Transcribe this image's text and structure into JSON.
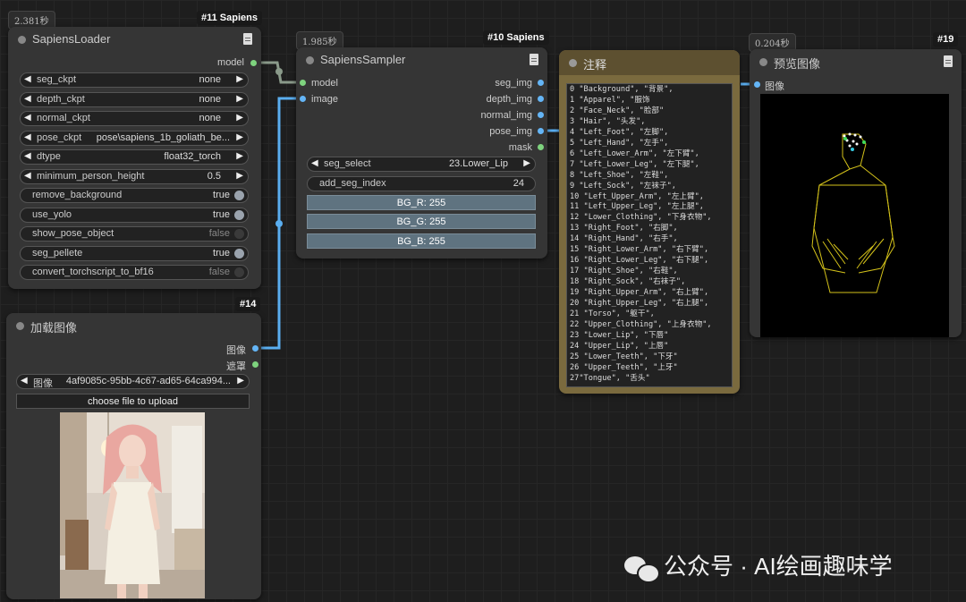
{
  "loader": {
    "time": "2.381秒",
    "tag": "#11 Sapiens",
    "title": "SapiensLoader",
    "output": "model",
    "combos": [
      {
        "label": "seg_ckpt",
        "value": "none"
      },
      {
        "label": "depth_ckpt",
        "value": "none"
      },
      {
        "label": "normal_ckpt",
        "value": "none"
      },
      {
        "label": "pose_ckpt",
        "value": "pose\\sapiens_1b_goliath_be..."
      },
      {
        "label": "dtype",
        "value": "float32_torch"
      },
      {
        "label": "minimum_person_height",
        "value": "0.5"
      }
    ],
    "toggles": [
      {
        "label": "remove_background",
        "value": "true"
      },
      {
        "label": "use_yolo",
        "value": "true"
      },
      {
        "label": "show_pose_object",
        "value": "false"
      },
      {
        "label": "seg_pellete",
        "value": "true"
      },
      {
        "label": "convert_torchscript_to_bf16",
        "value": "false"
      }
    ]
  },
  "image_loader": {
    "tag": "#14",
    "title": "加载图像",
    "outputs": [
      "图像",
      "遮罩"
    ],
    "file_label": "图像",
    "file_value": "4af9085c-95bb-4c67-ad65-64ca994...",
    "upload_label": "choose file to upload"
  },
  "sampler": {
    "time": "1.985秒",
    "tag": "#10 Sapiens",
    "title": "SapiensSampler",
    "inputs": [
      "model",
      "image"
    ],
    "outputs": [
      "seg_img",
      "depth_img",
      "normal_img",
      "pose_img",
      "mask"
    ],
    "seg_select_label": "seg_select",
    "seg_select_value": "23.Lower_Lip",
    "add_seg_label": "add_seg_index",
    "add_seg_value": "24",
    "bg_r": "BG_R: 255",
    "bg_g": "BG_G: 255",
    "bg_b": "BG_B: 255"
  },
  "note": {
    "title": "注释",
    "text": "0 \"Background\", \"背景\",\n1 \"Apparel\", \"服饰\n2 \"Face_Neck\", \"脸部\"\n3 \"Hair\", \"头发\",\n4 \"Left_Foot\", \"左脚\",\n5 \"Left_Hand\", \"左手\",\n6 \"Left_Lower_Arm\", \"左下臂\",\n7 \"Left_Lower_Leg\", \"左下腿\",\n8 \"Left_Shoe\", \"左鞋\",\n9 \"Left_Sock\", \"左袜子\",\n10 \"Left_Upper_Arm\", \"左上臂\",\n11 \"Left_Upper_Leg\", \"左上腿\",\n12 \"Lower_Clothing\", \"下身衣物\",\n13 \"Right_Foot\", \"右脚\",\n14 \"Right_Hand\", \"右手\",\n15 \"Right_Lower_Arm\", \"右下臂\",\n16 \"Right_Lower_Leg\", \"右下腿\",\n17 \"Right_Shoe\", \"右鞋\",\n18 \"Right_Sock\", \"右袜子\",\n19 \"Right_Upper_Arm\", \"右上臂\",\n20 \"Right_Upper_Leg\", \"右上腿\",\n21 \"Torso\", \"躯干\",\n22 \"Upper_Clothing\", \"上身衣物\",\n23 \"Lower_Lip\", \"下唇\"\n24 \"Upper_Lip\", \"上唇\"\n25 \"Lower_Teeth\", \"下牙\"\n26 \"Upper_Teeth\", \"上牙\"\n27\"Tongue\", \"舌头\""
  },
  "preview": {
    "time": "0.204秒",
    "tag": "#19",
    "title": "预览图像",
    "input": "图像"
  },
  "watermark": "公众号 · AI绘画趣味学",
  "colors": {
    "model_socket": "#7ed37e",
    "image_socket": "#64b5f6",
    "note_border": "#7a6a3e",
    "toggle_on": "#9aa3ad"
  }
}
